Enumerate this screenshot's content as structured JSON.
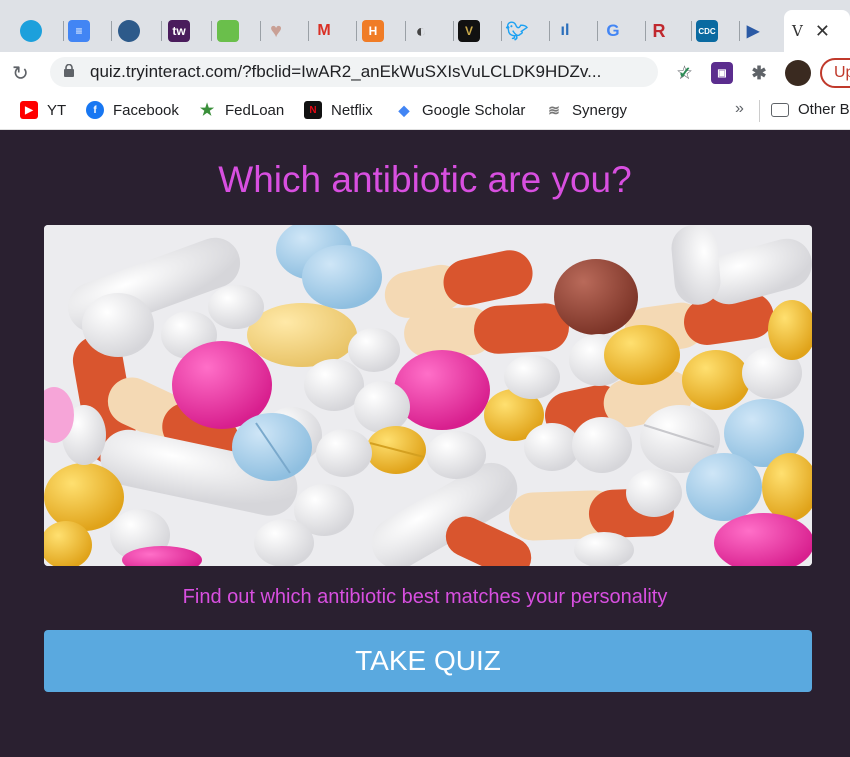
{
  "browser": {
    "address_url": "quiz.tryinteract.com/?fbclid=IwAR2_anEkWuSXIsVuLCLDK9HDZv...",
    "active_tab_label": "V",
    "update_label": "Up"
  },
  "bookmarks": [
    {
      "label": "YT",
      "icon": "youtube-icon",
      "color": "#ff0000"
    },
    {
      "label": "Facebook",
      "icon": "facebook-icon",
      "color": "#1877f2"
    },
    {
      "label": "FedLoan",
      "icon": "fedloan-icon",
      "color": "#3a8f3a"
    },
    {
      "label": "Netflix",
      "icon": "netflix-icon",
      "color": "#e50914"
    },
    {
      "label": "Google Scholar",
      "icon": "graduation-cap-icon",
      "color": "#4285f4"
    },
    {
      "label": "Synergy",
      "icon": "synergy-icon",
      "color": "#777777"
    },
    {
      "label": "Other B",
      "icon": "folder-icon",
      "color": "#5f6368"
    }
  ],
  "quiz": {
    "title": "Which antibiotic are you?",
    "subtitle": "Find out which antibiotic best matches your personality",
    "cta_label": "TAKE QUIZ"
  },
  "colors": {
    "background": "#2a2030",
    "accent_text": "#d84fe0",
    "button": "#5aa9df"
  }
}
